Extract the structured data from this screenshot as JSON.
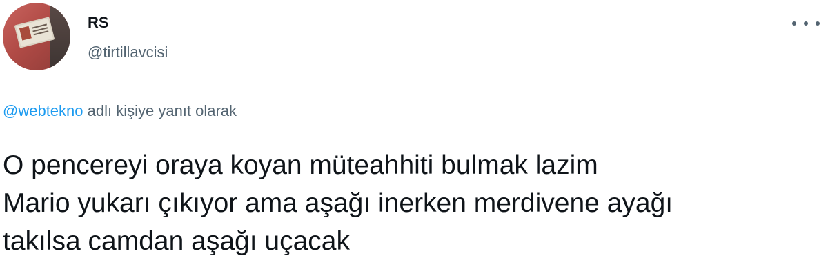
{
  "user": {
    "display_name": "RS",
    "handle": "@tirtillavcisi"
  },
  "reply": {
    "mention": "@webtekno",
    "suffix": " adlı kişiye yanıt olarak"
  },
  "tweet": {
    "lines": [
      "O pencereyi oraya koyan müteahhiti bulmak lazim",
      "Mario yukarı çıkıyor ama aşağı inerken merdivene ayağı",
      "takılsa camdan aşağı uçacak"
    ]
  },
  "icons": {
    "more": "more-horizontal-icon"
  },
  "colors": {
    "text": "#0f1419",
    "secondary": "#536471",
    "link": "#1d9bf0"
  }
}
